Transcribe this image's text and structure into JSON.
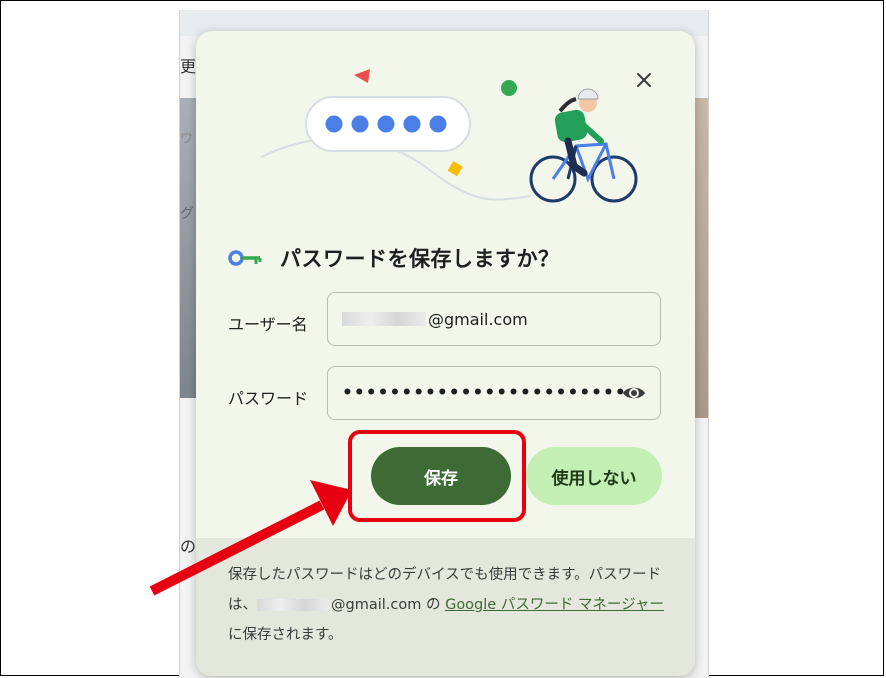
{
  "background": {
    "fragments": [
      "更",
      "ワ",
      "グ",
      "の"
    ]
  },
  "dialog": {
    "title": "パスワードを保存しますか？",
    "close_icon": "close-icon",
    "key_icon": "key-icon",
    "username": {
      "label": "ユーザー名",
      "value": "@gmail.com"
    },
    "password": {
      "label": "パスワード",
      "value": "••••••••••••••••••••••••",
      "reveal_icon": "eye-icon"
    },
    "buttons": {
      "save": "保存",
      "never": "使用しない"
    },
    "footer": {
      "text_1": "保存したパスワードはどのデバイスでも使用できます。パスワードは、",
      "email": "@gmail.com",
      "text_2": " の ",
      "link": "Google パスワード マネージャー",
      "text_3": " に保存されます。"
    }
  },
  "colors": {
    "dialog_bg": "#f3f6ea",
    "save_button": "#3d6a35",
    "never_button": "#c4efb4",
    "annotation": "#e60012",
    "link": "#3d6a35"
  }
}
